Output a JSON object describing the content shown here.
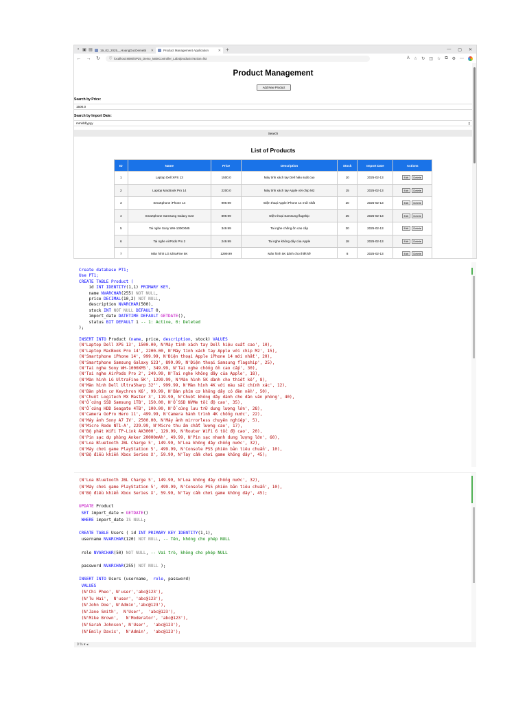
{
  "browser": {
    "tabs": [
      {
        "label": "19_02_2025__HoangDucDemeBi"
      },
      {
        "label": "Product Management Application"
      }
    ],
    "url": "localhost:8080/SP25_Demo_MainController_Lab4/products?action=list"
  },
  "page": {
    "title": "Product Management",
    "add_button": "Add New Product",
    "search_price_label": "Search by Price:",
    "search_price_value": "1500.0",
    "search_date_label": "Search by Import Date:",
    "search_date_placeholder": "mm/dd/yyyy",
    "search_button": "Search",
    "list_title": "List of Products",
    "table": {
      "headers": [
        "ID",
        "Name",
        "Price",
        "Description",
        "Stock",
        "Import Date",
        "Actions"
      ],
      "edit_label": "Edit",
      "delete_label": "Delete",
      "rows": [
        {
          "id": "1",
          "name": "Laptop Dell XPS 13",
          "price": "1500.0",
          "description": "Máy tính xách tay Dell hiệu suất cao",
          "stock": "10",
          "date": "2025-02-13"
        },
        {
          "id": "2",
          "name": "Laptop MacBook Pro 14",
          "price": "2200.0",
          "description": "Máy tính xách tay Apple với chip M2",
          "stock": "15",
          "date": "2025-02-13"
        },
        {
          "id": "3",
          "name": "Smartphone iPhone 14",
          "price": "999.99",
          "description": "Điện thoại Apple iPhone 14 mới nhất",
          "stock": "20",
          "date": "2025-02-13"
        },
        {
          "id": "4",
          "name": "Smartphone Samsung Galaxy S23",
          "price": "899.99",
          "description": "Điện thoại Samsung flagship",
          "stock": "25",
          "date": "2025-02-13"
        },
        {
          "id": "5",
          "name": "Tai nghe Sony WH-1000XM5",
          "price": "349.99",
          "description": "Tai nghe chống ồn cao cấp",
          "stock": "30",
          "date": "2025-02-13"
        },
        {
          "id": "6",
          "name": "Tai nghe AirPods Pro 2",
          "price": "249.99",
          "description": "Tai nghe không dây của Apple",
          "stock": "18",
          "date": "2025-02-13"
        },
        {
          "id": "7",
          "name": "Màn hình LG UltraFine 5K",
          "price": "1299.99",
          "description": "Màn hình 5K dành cho thiết kế",
          "stock": "8",
          "date": "2025-02-13"
        }
      ]
    }
  },
  "sql1": {
    "l1": "Create database PT1;",
    "l2": "Use PT1;",
    "l3": "CREATE TABLE Product (",
    "l4a": "    id ",
    "l4b": "INT IDENTITY",
    "l4c": "(1,1) ",
    "l4d": "PRIMARY KEY",
    "l5a": "    name ",
    "l5b": "NVARCHAR",
    "l5c": "(255) ",
    "l5d": "NOT NULL",
    "l6a": "    price ",
    "l6b": "DECIMAL",
    "l6c": "(10,2) ",
    "l6d": "NOT NULL",
    "l7a": "    description ",
    "l7b": "NVARCHAR",
    "l7c": "(500),",
    "l8a": "    stock ",
    "l8b": "INT",
    "l8c": " NOT NULL ",
    "l8d": "DEFAULT",
    "l8e": " 0,",
    "l9a": "    import_date ",
    "l9b": "DATETIME DEFAULT",
    "l9c": " GETDATE",
    "l9d": "(),",
    "l10a": "    status ",
    "l10b": "BIT DEFAULT",
    "l10c": " 1 ",
    "l10d": "-- 1: Active, 0: Deleted",
    "l11": ");",
    "ins_a": "INSERT INTO",
    "ins_b": " Product (",
    "ins_c": "name",
    "ins_d": ", price, ",
    "ins_e": "description",
    "ins_f": ", stock) ",
    "ins_g": "VALUES",
    "values": [
      "(N'Laptop Dell XPS 13', 1500.00, N'Máy tính xách tay Dell hiệu suất cao', 10),",
      "(N'Laptop MacBook Pro 14', 2200.00, N'Máy tính xách tay Apple với chip M2', 15),",
      "(N'Smartphone iPhone 14', 999.99, N'Điện thoại Apple iPhone 14 mới nhất', 20),",
      "(N'Smartphone Samsung Galaxy S23', 899.99, N'Điện thoại Samsung flagship', 25),",
      "(N'Tai nghe Sony WH-1000XM5', 349.99, N'Tai nghe chống ồn cao cấp', 30),",
      "(N'Tai nghe AirPods Pro 2', 249.99, N'Tai nghe không dây của Apple', 18),",
      "(N'Màn hình LG UltraFine 5K', 1299.99, N'Màn hình 5K dành cho thiết kế', 8),",
      "(N'Màn hình Dell UltraSharp 32\"', 999.99, N'Màn hình 4K với màu sắc chính xác', 12),",
      "(N'Bàn phím cơ Keychron K6', 99.99, N'Bàn phím cơ không dây có đèn nền', 50),",
      "(N'Chuột Logitech MX Master 3', 119.99, N'Chuột không dây dành cho dân văn phòng', 40),",
      "(N'Ổ cứng SSD Samsung 1TB', 150.00, N'Ổ SSD NVMe tốc độ cao', 35),",
      "(N'Ổ cứng HDD Seagate 4TB', 100.00, N'Ổ cứng lưu trữ dung lượng lớn', 28),",
      "(N'Camera GoPro Hero 11', 499.99, N'Camera hành trình 4K chống nước', 22),",
      "(N'Máy ảnh Sony A7 IV', 2500.00, N'Máy ảnh mirrorless chuyên nghiệp', 5),",
      "(N'Micro Rode NT1-A', 229.99, N'Micro thu âm chất lượng cao', 17),",
      "(N'Bộ phát WiFi TP-Link AX3000', 129.99, N'Router WiFi 6 tốc độ cao', 20),",
      "(N'Pin sạc dự phòng Anker 20000mAh', 49.99, N'Pin sạc nhanh dung lượng lớn', 60),",
      "(N'Loa Bluetooth JBL Charge 5', 149.99, N'Loa không dây chống nước', 32),",
      "(N'Máy chơi game PlayStation 5', 499.99, N'Console PS5 phiên bản tiêu chuẩn', 10),",
      "(N'Bộ điều khiển Xbox Series X', 59.99, N'Tay cầm chơi game không dây', 45);"
    ]
  },
  "sql2": {
    "v1": "(N'Loa Bluetooth JBL Charge 5', 149.99, N'Loa không dây chống nước', 32),",
    "v2": "(N'Máy chơi game PlayStation 5', 499.99, N'Console PS5 phiên bản tiêu chuẩn', 10),",
    "v3": "(N'Bộ điều khiển Xbox Series X', 59.99, N'Tay cầm chơi game không dây', 45);",
    "u1a": "UPDATE",
    "u1b": " Product",
    "u2a": " SET",
    "u2b": " import_date = ",
    "u2c": "GETDATE",
    "u2d": "()",
    "u3a": " WHERE",
    "u3b": " import_date ",
    "u3c": "IS NULL",
    "u3d": ";",
    "c1a": "CREATE TABLE",
    "c1b": " Users ( id ",
    "c1c": "INT PRIMARY KEY IDENTITY",
    "c1d": "(1,1),",
    "c2a": " username ",
    "c2b": "NVARCHAR",
    "c2c": "(120) ",
    "c2d": "NOT NULL",
    "c2e": ", ",
    "c2f": "-- Tên, không cho phép NULL",
    "c3a": " role ",
    "c3b": "NVARCHAR",
    "c3c": "(50) ",
    "c3d": "NOT NULL",
    "c3e": ", ",
    "c3f": "-- Vai trò, không cho phép NULL",
    "c4a": " password ",
    "c4b": "NVARCHAR",
    "c4c": "(255) ",
    "c4d": "NOT NULL",
    "c4e": " );",
    "i1a": "INSERT INTO",
    "i1b": " Users (username,  ",
    "i1c": "role",
    "i1d": ", password)",
    "i2": " VALUES",
    "users": [
      " (N'Chi Pheo', N'user','abc@123'),",
      " (N'Tu Hai',  N'user', 'abc@123'),",
      " (N'John Doe', N'Admin','abc@123'),",
      " (N'Jane Smith',  N'User',  'abc@123'),",
      " (N'Mike Brown',   N'Moderator', 'abc@123'),",
      " (N'Sarah Johnson', N'User',  'abc@123'),",
      " (N'Emily Davis',  N'Admin',  'abc@123');"
    ]
  },
  "editor_status": {
    "zoom": "0 %"
  }
}
